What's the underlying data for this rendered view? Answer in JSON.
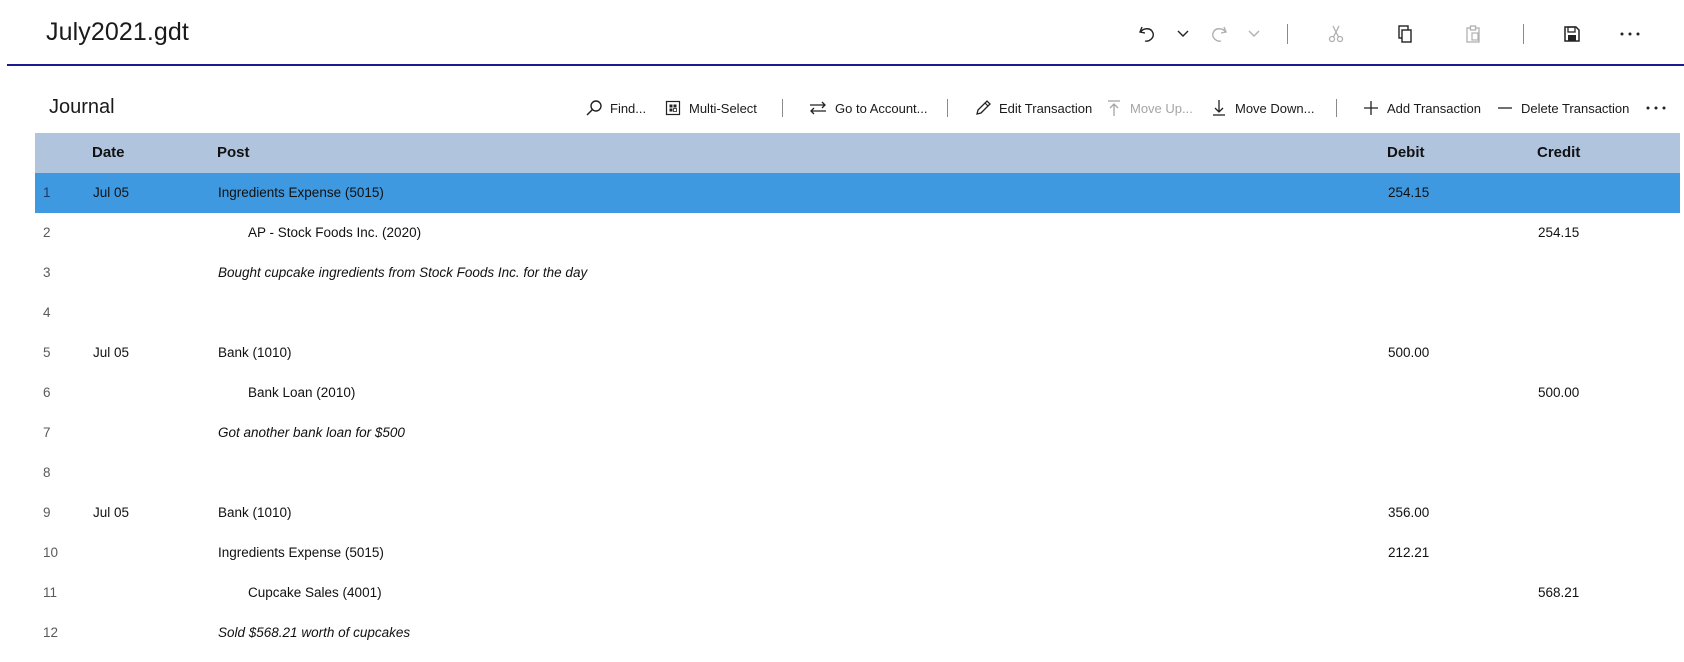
{
  "window": {
    "title": "July2021.gdt",
    "accent_color": "#1b1b8f",
    "toolbar_icons": [
      "undo-icon",
      "undo-dropdown-icon",
      "redo-icon",
      "redo-dropdown-icon",
      "cut-icon",
      "copy-icon",
      "paste-icon",
      "save-icon",
      "more-icon"
    ]
  },
  "journal": {
    "title": "Journal",
    "commands": {
      "find": "Find...",
      "multi_select": "Multi-Select",
      "go_to_account": "Go to Account...",
      "edit_transaction": "Edit Transaction",
      "move_up": "Move Up...",
      "move_down": "Move Down...",
      "add_transaction": "Add Transaction",
      "delete_transaction": "Delete Transaction"
    }
  },
  "grid": {
    "header_color": "#b0c4de",
    "selected_color": "#3f99e0",
    "columns": {
      "date": "Date",
      "post": "Post",
      "debit": "Debit",
      "credit": "Credit"
    },
    "rows": [
      {
        "num": "1",
        "date": "Jul 05",
        "post": "Ingredients Expense (5015)",
        "debit": "254.15",
        "credit": "",
        "kind": "debit",
        "selected": true
      },
      {
        "num": "2",
        "date": "",
        "post": "AP - Stock Foods Inc. (2020)",
        "debit": "",
        "credit": "254.15",
        "kind": "credit"
      },
      {
        "num": "3",
        "date": "",
        "post": "Bought cupcake ingredients from Stock Foods Inc. for the day",
        "debit": "",
        "credit": "",
        "kind": "memo"
      },
      {
        "num": "4",
        "date": "",
        "post": "",
        "debit": "",
        "credit": "",
        "kind": "blank"
      },
      {
        "num": "5",
        "date": "Jul 05",
        "post": "Bank (1010)",
        "debit": "500.00",
        "credit": "",
        "kind": "debit"
      },
      {
        "num": "6",
        "date": "",
        "post": "Bank Loan (2010)",
        "debit": "",
        "credit": "500.00",
        "kind": "credit"
      },
      {
        "num": "7",
        "date": "",
        "post": "Got another bank loan for $500",
        "debit": "",
        "credit": "",
        "kind": "memo"
      },
      {
        "num": "8",
        "date": "",
        "post": "",
        "debit": "",
        "credit": "",
        "kind": "blank"
      },
      {
        "num": "9",
        "date": "Jul 05",
        "post": "Bank (1010)",
        "debit": "356.00",
        "credit": "",
        "kind": "debit"
      },
      {
        "num": "10",
        "date": "",
        "post": "Ingredients Expense (5015)",
        "debit": "212.21",
        "credit": "",
        "kind": "debit"
      },
      {
        "num": "11",
        "date": "",
        "post": "Cupcake Sales (4001)",
        "debit": "",
        "credit": "568.21",
        "kind": "credit"
      },
      {
        "num": "12",
        "date": "",
        "post": "Sold $568.21 worth of cupcakes",
        "debit": "",
        "credit": "",
        "kind": "memo"
      }
    ]
  }
}
